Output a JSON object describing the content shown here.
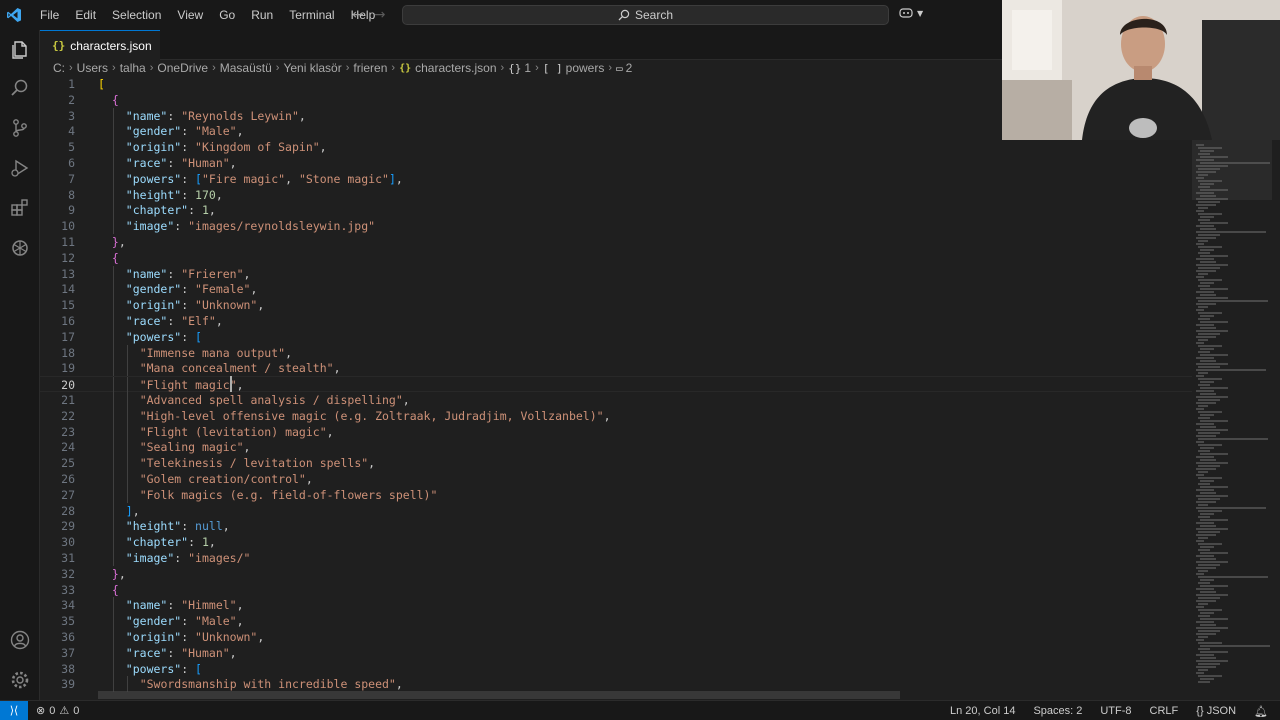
{
  "menu": [
    "File",
    "Edit",
    "Selection",
    "View",
    "Go",
    "Run",
    "Terminal",
    "Help"
  ],
  "search": {
    "label": "Search"
  },
  "tab": {
    "filename": "characters.json",
    "icon": "{}"
  },
  "breadcrumb": {
    "segments": [
      "C:",
      "Users",
      "talha",
      "OneDrive",
      "Masaüstü",
      "Yeni klasör",
      "frieren"
    ],
    "file": "characters.json",
    "symbols": [
      {
        "icon": "{}",
        "label": "1"
      },
      {
        "icon": "[ ]",
        "label": "powers"
      },
      {
        "icon": "▭",
        "label": "2"
      }
    ]
  },
  "editor": {
    "current_line": 20,
    "lines": [
      {
        "n": 1,
        "indent": 0,
        "t": [
          [
            "b1",
            "["
          ]
        ]
      },
      {
        "n": 2,
        "indent": 1,
        "t": [
          [
            "b2",
            "{"
          ]
        ]
      },
      {
        "n": 3,
        "indent": 2,
        "t": [
          [
            "k",
            "\"name\""
          ],
          [
            "p",
            ": "
          ],
          [
            "s",
            "\"Reynolds Leywin\""
          ],
          [
            "p",
            ","
          ]
        ]
      },
      {
        "n": 4,
        "indent": 2,
        "t": [
          [
            "k",
            "\"gender\""
          ],
          [
            "p",
            ": "
          ],
          [
            "s",
            "\"Male\""
          ],
          [
            "p",
            ","
          ]
        ]
      },
      {
        "n": 5,
        "indent": 2,
        "t": [
          [
            "k",
            "\"origin\""
          ],
          [
            "p",
            ": "
          ],
          [
            "s",
            "\"Kingdom of Sapin\""
          ],
          [
            "p",
            ","
          ]
        ]
      },
      {
        "n": 6,
        "indent": 2,
        "t": [
          [
            "k",
            "\"race\""
          ],
          [
            "p",
            ": "
          ],
          [
            "s",
            "\"Human\""
          ],
          [
            "p",
            ","
          ]
        ]
      },
      {
        "n": 7,
        "indent": 2,
        "t": [
          [
            "k",
            "\"powers\""
          ],
          [
            "p",
            ": "
          ],
          [
            "b3",
            "["
          ],
          [
            "s",
            "\"Fire magic\""
          ],
          [
            "p",
            ", "
          ],
          [
            "s",
            "\"Stone magic\""
          ],
          [
            "b3",
            "]"
          ],
          [
            "p",
            ","
          ]
        ]
      },
      {
        "n": 8,
        "indent": 2,
        "t": [
          [
            "k",
            "\"height\""
          ],
          [
            "p",
            ": "
          ],
          [
            "n",
            "170"
          ],
          [
            "p",
            ","
          ]
        ]
      },
      {
        "n": 9,
        "indent": 2,
        "t": [
          [
            "k",
            "\"chapter\""
          ],
          [
            "p",
            ": "
          ],
          [
            "n",
            "1"
          ],
          [
            "p",
            ","
          ]
        ]
      },
      {
        "n": 10,
        "indent": 2,
        "t": [
          [
            "k",
            "\"image\""
          ],
          [
            "p",
            ": "
          ],
          [
            "s",
            "\"images/reynoldsleywin.jpg\""
          ]
        ]
      },
      {
        "n": 11,
        "indent": 1,
        "t": [
          [
            "b2",
            "}"
          ],
          [
            "p",
            ","
          ]
        ]
      },
      {
        "n": 12,
        "indent": 1,
        "t": [
          [
            "b2",
            "{"
          ]
        ]
      },
      {
        "n": 13,
        "indent": 2,
        "t": [
          [
            "k",
            "\"name\""
          ],
          [
            "p",
            ": "
          ],
          [
            "s",
            "\"Frieren\""
          ],
          [
            "p",
            ","
          ]
        ]
      },
      {
        "n": 14,
        "indent": 2,
        "t": [
          [
            "k",
            "\"gender\""
          ],
          [
            "p",
            ": "
          ],
          [
            "s",
            "\"Female\""
          ],
          [
            "p",
            ","
          ]
        ]
      },
      {
        "n": 15,
        "indent": 2,
        "t": [
          [
            "k",
            "\"origin\""
          ],
          [
            "p",
            ": "
          ],
          [
            "s",
            "\"Unknown\""
          ],
          [
            "p",
            ","
          ]
        ]
      },
      {
        "n": 16,
        "indent": 2,
        "t": [
          [
            "k",
            "\"race\""
          ],
          [
            "p",
            ": "
          ],
          [
            "s",
            "\"Elf\""
          ],
          [
            "p",
            ","
          ]
        ]
      },
      {
        "n": 17,
        "indent": 2,
        "t": [
          [
            "k",
            "\"powers\""
          ],
          [
            "p",
            ": "
          ],
          [
            "b3",
            "["
          ]
        ]
      },
      {
        "n": 18,
        "indent": 3,
        "t": [
          [
            "s",
            "\"Immense mana output\""
          ],
          [
            "p",
            ","
          ]
        ]
      },
      {
        "n": 19,
        "indent": 3,
        "t": [
          [
            "s",
            "\"Mana concealment / stealth\""
          ],
          [
            "p",
            ","
          ]
        ]
      },
      {
        "n": 20,
        "indent": 3,
        "t": [
          [
            "s",
            "\"Flight magic\""
          ],
          [
            "p",
            ","
          ]
        ]
      },
      {
        "n": 21,
        "indent": 3,
        "t": [
          [
            "s",
            "\"Advanced spell analysis / dispelling\""
          ],
          [
            "p",
            ","
          ]
        ]
      },
      {
        "n": 22,
        "indent": 3,
        "t": [
          [
            "s",
            "\"High-level offensive magic (e.g. Zoltraak, Judradjim, Vollzanbel)\""
          ],
          [
            "p",
            ","
          ]
        ]
      },
      {
        "n": 23,
        "indent": 3,
        "t": [
          [
            "s",
            "\"Flight (levitation) magic\""
          ],
          [
            "p",
            ","
          ]
        ]
      },
      {
        "n": 24,
        "indent": 3,
        "t": [
          [
            "s",
            "\"Sealing magic\""
          ],
          [
            "p",
            ","
          ]
        ]
      },
      {
        "n": 25,
        "indent": 3,
        "t": [
          [
            "s",
            "\"Telekinesis / levitation spells\""
          ],
          [
            "p",
            ","
          ]
        ]
      },
      {
        "n": 26,
        "indent": 3,
        "t": [
          [
            "s",
            "\"Golem creation/control\""
          ],
          [
            "p",
            ","
          ]
        ]
      },
      {
        "n": 27,
        "indent": 3,
        "t": [
          [
            "s",
            "\"Folk magics (e.g. field-of-flowers spell)\""
          ]
        ]
      },
      {
        "n": 28,
        "indent": 2,
        "t": [
          [
            "b3",
            "]"
          ],
          [
            "p",
            ","
          ]
        ]
      },
      {
        "n": 29,
        "indent": 2,
        "t": [
          [
            "k",
            "\"height\""
          ],
          [
            "p",
            ": "
          ],
          [
            "kw",
            "null"
          ],
          [
            "p",
            ","
          ]
        ]
      },
      {
        "n": 30,
        "indent": 2,
        "t": [
          [
            "k",
            "\"chapter\""
          ],
          [
            "p",
            ": "
          ],
          [
            "n",
            "1"
          ],
          [
            "p",
            ","
          ]
        ]
      },
      {
        "n": 31,
        "indent": 2,
        "t": [
          [
            "k",
            "\"image\""
          ],
          [
            "p",
            ": "
          ],
          [
            "s",
            "\"images/\""
          ]
        ]
      },
      {
        "n": 32,
        "indent": 1,
        "t": [
          [
            "b2",
            "}"
          ],
          [
            "p",
            ","
          ]
        ]
      },
      {
        "n": 33,
        "indent": 1,
        "t": [
          [
            "b2",
            "{"
          ]
        ]
      },
      {
        "n": 34,
        "indent": 2,
        "t": [
          [
            "k",
            "\"name\""
          ],
          [
            "p",
            ": "
          ],
          [
            "s",
            "\"Himmel\""
          ],
          [
            "p",
            ","
          ]
        ]
      },
      {
        "n": 35,
        "indent": 2,
        "t": [
          [
            "k",
            "\"gender\""
          ],
          [
            "p",
            ": "
          ],
          [
            "s",
            "\"Male\""
          ],
          [
            "p",
            ","
          ]
        ]
      },
      {
        "n": 36,
        "indent": 2,
        "t": [
          [
            "k",
            "\"origin\""
          ],
          [
            "p",
            ": "
          ],
          [
            "s",
            "\"Unknown\""
          ],
          [
            "p",
            ","
          ]
        ]
      },
      {
        "n": 37,
        "indent": 2,
        "t": [
          [
            "k",
            "\"race\""
          ],
          [
            "p",
            ": "
          ],
          [
            "s",
            "\"Human\""
          ],
          [
            "p",
            ","
          ]
        ]
      },
      {
        "n": 38,
        "indent": 2,
        "t": [
          [
            "k",
            "\"powers\""
          ],
          [
            "p",
            ": "
          ],
          [
            "b3",
            "["
          ]
        ]
      },
      {
        "n": 39,
        "indent": 3,
        "t": [
          [
            "s",
            "\"Swordsmanship with incredible speed\""
          ],
          [
            "p",
            ","
          ]
        ]
      }
    ]
  },
  "status": {
    "errors": "0",
    "warnings": "0",
    "position": "Ln 20, Col 14",
    "spaces": "Spaces: 2",
    "encoding": "UTF-8",
    "eol": "CRLF",
    "language": "JSON"
  },
  "colors": {
    "accent": "#0078d4",
    "string": "#ce9178",
    "key": "#9cdcfe",
    "number": "#b5cea8"
  }
}
